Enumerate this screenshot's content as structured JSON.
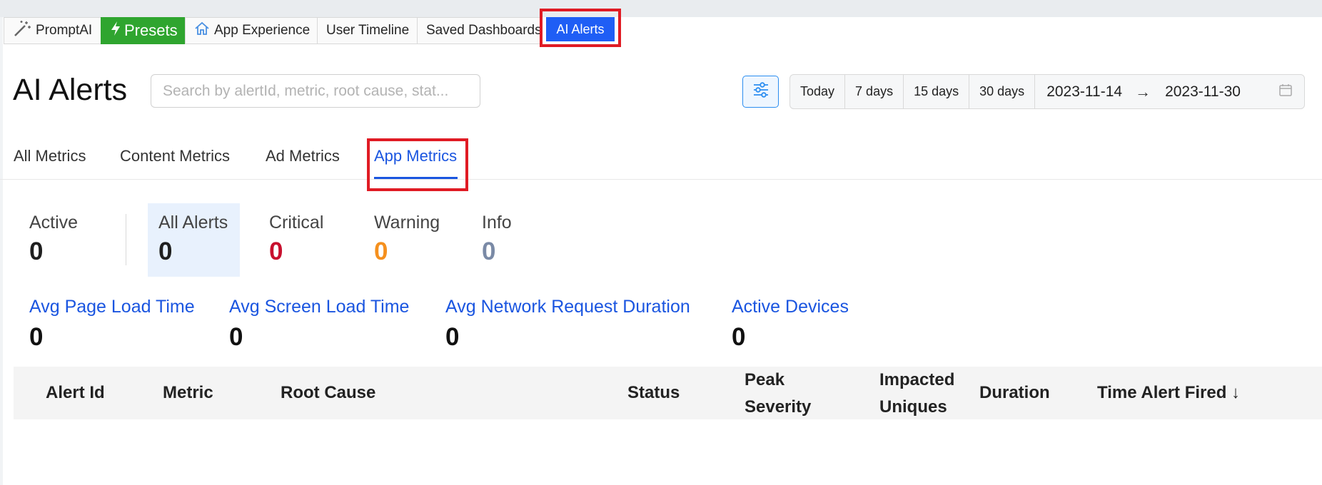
{
  "tabs": [
    {
      "label": "PromptAI",
      "icon": "magic-wand-icon"
    },
    {
      "label": "Presets",
      "icon": "lightning-icon"
    },
    {
      "label": "App Experience",
      "icon": "home-icon"
    },
    {
      "label": "User Timeline"
    },
    {
      "label": "Saved Dashboards"
    },
    {
      "label": "AI Alerts"
    }
  ],
  "header": {
    "title": "AI Alerts",
    "search_placeholder": "Search by alertId, metric, root cause, stat..."
  },
  "date_range": {
    "presets": [
      "Today",
      "7 days",
      "15 days",
      "30 days"
    ],
    "start": "2023-11-14",
    "end": "2023-11-30"
  },
  "metric_tabs": [
    "All Metrics",
    "Content Metrics",
    "Ad Metrics",
    "App Metrics"
  ],
  "active_metric_tab": "App Metrics",
  "counters": [
    {
      "label": "Active",
      "value": "0",
      "color": "#1f1f1f"
    },
    {
      "label": "All Alerts",
      "value": "0",
      "color": "#1f1f1f"
    },
    {
      "label": "Critical",
      "value": "0",
      "color": "#c8102e"
    },
    {
      "label": "Warning",
      "value": "0",
      "color": "#f5901e"
    },
    {
      "label": "Info",
      "value": "0",
      "color": "#7a8aa6"
    }
  ],
  "kpis": [
    {
      "label": "Avg Page Load Time",
      "value": "0"
    },
    {
      "label": "Avg Screen Load Time",
      "value": "0"
    },
    {
      "label": "Avg Network Request Duration",
      "value": "0"
    },
    {
      "label": "Active Devices",
      "value": "0"
    }
  ],
  "table": {
    "columns": [
      {
        "line1": "Alert Id",
        "line2": ""
      },
      {
        "line1": "Metric",
        "line2": ""
      },
      {
        "line1": "Root Cause",
        "line2": ""
      },
      {
        "line1": "Status",
        "line2": ""
      },
      {
        "line1": "Peak",
        "line2": "Severity"
      },
      {
        "line1": "Impacted",
        "line2": "Uniques"
      },
      {
        "line1": "Duration",
        "line2": ""
      },
      {
        "line1": "Time Alert Fired ↓",
        "line2": ""
      }
    ]
  },
  "colors": {
    "accent": "#1a55e0",
    "presets_green": "#2fa52f",
    "ai_alerts_blue": "#1f5ef5",
    "highlight_red": "#e01b24"
  }
}
